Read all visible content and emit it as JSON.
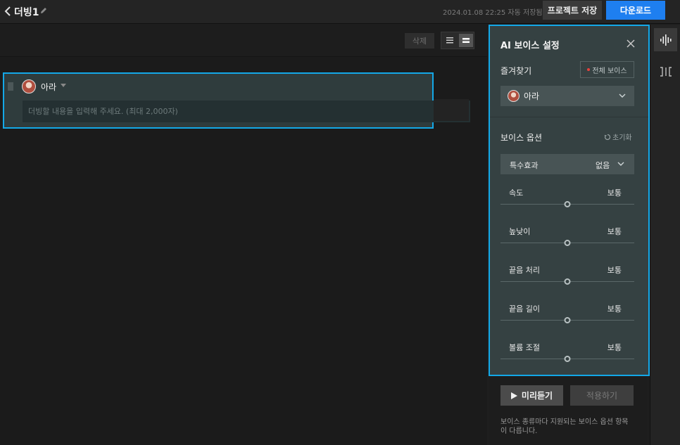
{
  "header": {
    "project_title": "더빙1",
    "autosave_text": "2024.01.08 22:25 자동 저장됨",
    "save_label": "프로젝트 저장",
    "download_label": "다운로드"
  },
  "toolbar": {
    "delete_label": "삭제"
  },
  "block": {
    "speaker": "아라",
    "placeholder": "더빙할 내용을 입력해 주세요. (최대 2,000자)",
    "value": ""
  },
  "panel": {
    "title": "AI 보이스 설정",
    "favorites_label": "즐겨찾기",
    "all_voices_label": "전체 보이스",
    "selected_voice": "아라",
    "options_label": "보이스 옵션",
    "reset_label": "초기화",
    "effect": {
      "label": "특수효과",
      "value": "없음"
    },
    "sliders": [
      {
        "label": "속도",
        "value": "보통",
        "level": 0.5
      },
      {
        "label": "높낮이",
        "value": "보통",
        "level": 0.5
      },
      {
        "label": "끝음 처리",
        "value": "보통",
        "level": 0.5
      },
      {
        "label": "끝음 길이",
        "value": "보통",
        "level": 0.5
      },
      {
        "label": "볼륨 조절",
        "value": "보통",
        "level": 0.5
      }
    ]
  },
  "actions": {
    "preview_label": "미리듣기",
    "apply_label": "적용하기",
    "help_text": "보이스 종류마다 지원되는 보이스 옵션 항목이 다릅니다."
  },
  "colors": {
    "accent": "#1e7ff0",
    "highlight": "#13a8e8",
    "panel_bg": "#354142"
  }
}
